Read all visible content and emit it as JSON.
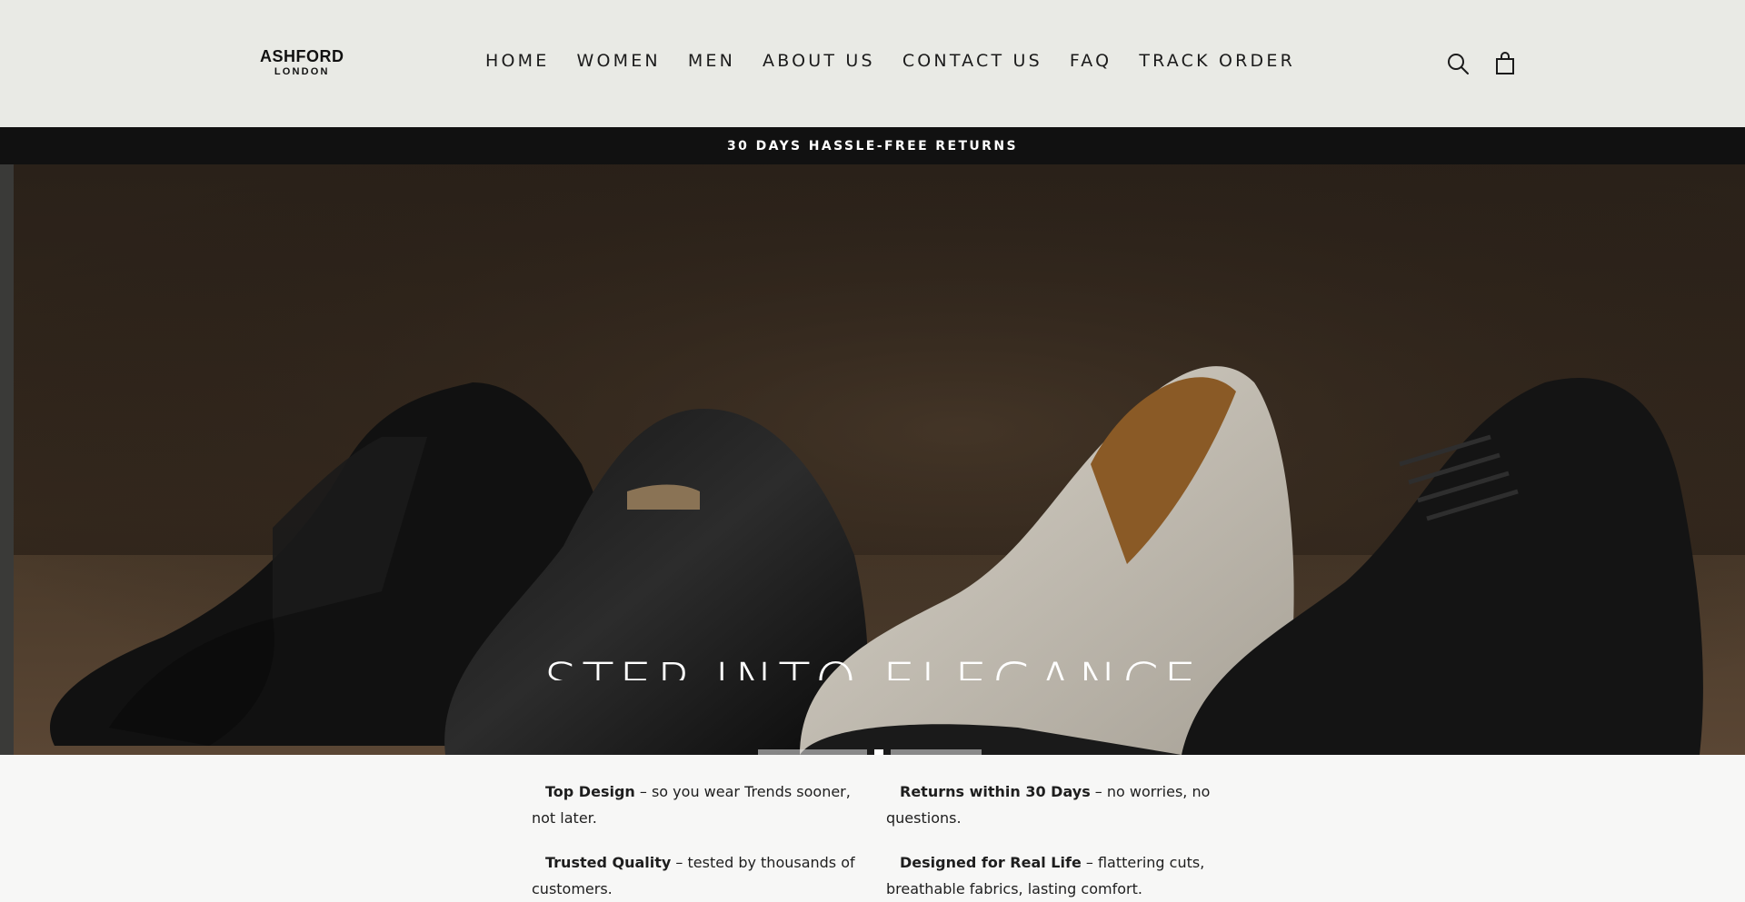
{
  "brand": {
    "name": "ASHFORD",
    "sub": "LONDON"
  },
  "nav": {
    "items": [
      {
        "label": "HOME",
        "name": "nav-home"
      },
      {
        "label": "WOMEN",
        "name": "nav-women"
      },
      {
        "label": "MEN",
        "name": "nav-men"
      },
      {
        "label": "ABOUT US",
        "name": "nav-about-us"
      },
      {
        "label": "CONTACT US",
        "name": "nav-contact-us"
      },
      {
        "label": "FAQ",
        "name": "nav-faq"
      },
      {
        "label": "TRACK ORDER",
        "name": "nav-track-order"
      }
    ]
  },
  "header_icons": {
    "search": "search-icon",
    "cart": "shopping-bag-icon"
  },
  "announcement": {
    "text": "30 DAYS HASSLE-FREE RETURNS"
  },
  "hero": {
    "title": "STEP INTO ELEGANCE",
    "slides_count": 2,
    "active_slide": 2
  },
  "features": [
    {
      "title": "Top Design",
      "text": " – so you wear Trends sooner, not later."
    },
    {
      "title": "Returns within 30 Days",
      "text": " – no worries, no questions."
    },
    {
      "title": "Trusted Quality",
      "text": " – tested by thousands of customers."
    },
    {
      "title": "Designed for Real Life",
      "text": " – flattering cuts, breathable fabrics, lasting comfort."
    }
  ],
  "colors": {
    "header_bg": "#e9eae5",
    "announcement_bg": "#111111",
    "page_bg": "#f7f7f6"
  }
}
